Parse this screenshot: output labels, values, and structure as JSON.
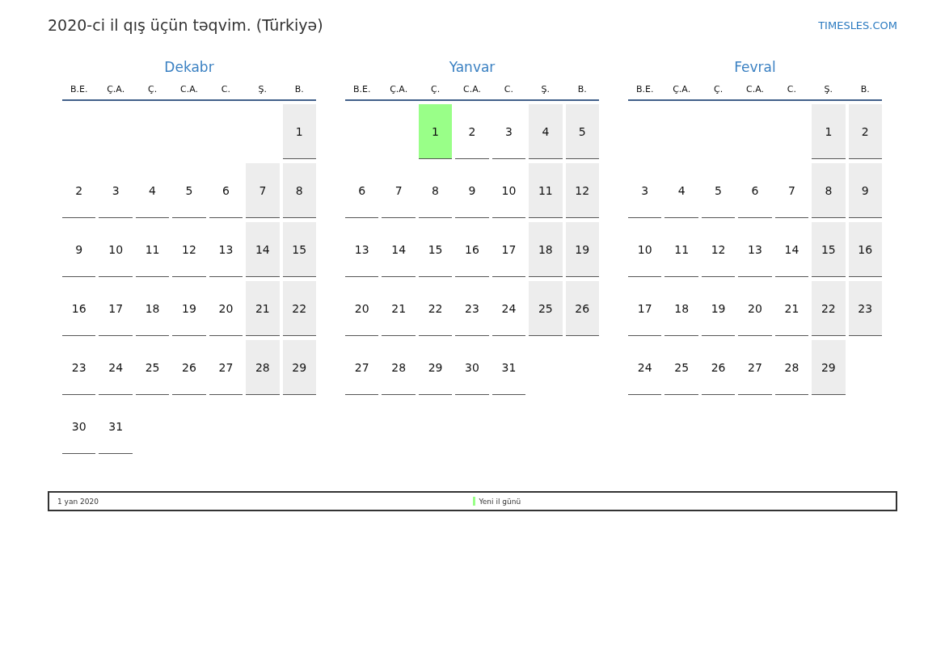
{
  "title": "2020-ci il qış üçün təqvim. (Türkiyə)",
  "site": "TIMESLES.COM",
  "months": [
    {
      "name": "Dekabr",
      "weekdays": [
        "B.E.",
        "Ç.A.",
        "Ç.",
        "C.A.",
        "C.",
        "Ş.",
        "B."
      ],
      "weeks": [
        [
          {
            "kind": "empty"
          },
          {
            "kind": "empty"
          },
          {
            "kind": "empty"
          },
          {
            "kind": "empty"
          },
          {
            "kind": "empty"
          },
          {
            "kind": "empty"
          },
          {
            "kind": "day",
            "day": "1",
            "weekend": true,
            "holiday": false
          }
        ],
        [
          {
            "kind": "day",
            "day": "2",
            "weekend": false,
            "holiday": false
          },
          {
            "kind": "day",
            "day": "3",
            "weekend": false,
            "holiday": false
          },
          {
            "kind": "day",
            "day": "4",
            "weekend": false,
            "holiday": false
          },
          {
            "kind": "day",
            "day": "5",
            "weekend": false,
            "holiday": false
          },
          {
            "kind": "day",
            "day": "6",
            "weekend": false,
            "holiday": false
          },
          {
            "kind": "day",
            "day": "7",
            "weekend": true,
            "holiday": false
          },
          {
            "kind": "day",
            "day": "8",
            "weekend": true,
            "holiday": false
          }
        ],
        [
          {
            "kind": "day",
            "day": "9",
            "weekend": false,
            "holiday": false
          },
          {
            "kind": "day",
            "day": "10",
            "weekend": false,
            "holiday": false
          },
          {
            "kind": "day",
            "day": "11",
            "weekend": false,
            "holiday": false
          },
          {
            "kind": "day",
            "day": "12",
            "weekend": false,
            "holiday": false
          },
          {
            "kind": "day",
            "day": "13",
            "weekend": false,
            "holiday": false
          },
          {
            "kind": "day",
            "day": "14",
            "weekend": true,
            "holiday": false
          },
          {
            "kind": "day",
            "day": "15",
            "weekend": true,
            "holiday": false
          }
        ],
        [
          {
            "kind": "day",
            "day": "16",
            "weekend": false,
            "holiday": false
          },
          {
            "kind": "day",
            "day": "17",
            "weekend": false,
            "holiday": false
          },
          {
            "kind": "day",
            "day": "18",
            "weekend": false,
            "holiday": false
          },
          {
            "kind": "day",
            "day": "19",
            "weekend": false,
            "holiday": false
          },
          {
            "kind": "day",
            "day": "20",
            "weekend": false,
            "holiday": false
          },
          {
            "kind": "day",
            "day": "21",
            "weekend": true,
            "holiday": false
          },
          {
            "kind": "day",
            "day": "22",
            "weekend": true,
            "holiday": false
          }
        ],
        [
          {
            "kind": "day",
            "day": "23",
            "weekend": false,
            "holiday": false
          },
          {
            "kind": "day",
            "day": "24",
            "weekend": false,
            "holiday": false
          },
          {
            "kind": "day",
            "day": "25",
            "weekend": false,
            "holiday": false
          },
          {
            "kind": "day",
            "day": "26",
            "weekend": false,
            "holiday": false
          },
          {
            "kind": "day",
            "day": "27",
            "weekend": false,
            "holiday": false
          },
          {
            "kind": "day",
            "day": "28",
            "weekend": true,
            "holiday": false
          },
          {
            "kind": "day",
            "day": "29",
            "weekend": true,
            "holiday": false
          }
        ],
        [
          {
            "kind": "day",
            "day": "30",
            "weekend": false,
            "holiday": false
          },
          {
            "kind": "day",
            "day": "31",
            "weekend": false,
            "holiday": false
          }
        ]
      ]
    },
    {
      "name": "Yanvar",
      "weekdays": [
        "B.E.",
        "Ç.A.",
        "Ç.",
        "C.A.",
        "C.",
        "Ş.",
        "B."
      ],
      "weeks": [
        [
          {
            "kind": "empty"
          },
          {
            "kind": "empty"
          },
          {
            "kind": "day",
            "day": "1",
            "weekend": false,
            "holiday": true
          },
          {
            "kind": "day",
            "day": "2",
            "weekend": false,
            "holiday": false
          },
          {
            "kind": "day",
            "day": "3",
            "weekend": false,
            "holiday": false
          },
          {
            "kind": "day",
            "day": "4",
            "weekend": true,
            "holiday": false
          },
          {
            "kind": "day",
            "day": "5",
            "weekend": true,
            "holiday": false
          }
        ],
        [
          {
            "kind": "day",
            "day": "6",
            "weekend": false,
            "holiday": false
          },
          {
            "kind": "day",
            "day": "7",
            "weekend": false,
            "holiday": false
          },
          {
            "kind": "day",
            "day": "8",
            "weekend": false,
            "holiday": false
          },
          {
            "kind": "day",
            "day": "9",
            "weekend": false,
            "holiday": false
          },
          {
            "kind": "day",
            "day": "10",
            "weekend": false,
            "holiday": false
          },
          {
            "kind": "day",
            "day": "11",
            "weekend": true,
            "holiday": false
          },
          {
            "kind": "day",
            "day": "12",
            "weekend": true,
            "holiday": false
          }
        ],
        [
          {
            "kind": "day",
            "day": "13",
            "weekend": false,
            "holiday": false
          },
          {
            "kind": "day",
            "day": "14",
            "weekend": false,
            "holiday": false
          },
          {
            "kind": "day",
            "day": "15",
            "weekend": false,
            "holiday": false
          },
          {
            "kind": "day",
            "day": "16",
            "weekend": false,
            "holiday": false
          },
          {
            "kind": "day",
            "day": "17",
            "weekend": false,
            "holiday": false
          },
          {
            "kind": "day",
            "day": "18",
            "weekend": true,
            "holiday": false
          },
          {
            "kind": "day",
            "day": "19",
            "weekend": true,
            "holiday": false
          }
        ],
        [
          {
            "kind": "day",
            "day": "20",
            "weekend": false,
            "holiday": false
          },
          {
            "kind": "day",
            "day": "21",
            "weekend": false,
            "holiday": false
          },
          {
            "kind": "day",
            "day": "22",
            "weekend": false,
            "holiday": false
          },
          {
            "kind": "day",
            "day": "23",
            "weekend": false,
            "holiday": false
          },
          {
            "kind": "day",
            "day": "24",
            "weekend": false,
            "holiday": false
          },
          {
            "kind": "day",
            "day": "25",
            "weekend": true,
            "holiday": false
          },
          {
            "kind": "day",
            "day": "26",
            "weekend": true,
            "holiday": false
          }
        ],
        [
          {
            "kind": "day",
            "day": "27",
            "weekend": false,
            "holiday": false
          },
          {
            "kind": "day",
            "day": "28",
            "weekend": false,
            "holiday": false
          },
          {
            "kind": "day",
            "day": "29",
            "weekend": false,
            "holiday": false
          },
          {
            "kind": "day",
            "day": "30",
            "weekend": false,
            "holiday": false
          },
          {
            "kind": "day",
            "day": "31",
            "weekend": false,
            "holiday": false
          }
        ]
      ]
    },
    {
      "name": "Fevral",
      "weekdays": [
        "B.E.",
        "Ç.A.",
        "Ç.",
        "C.A.",
        "C.",
        "Ş.",
        "B."
      ],
      "weeks": [
        [
          {
            "kind": "empty"
          },
          {
            "kind": "empty"
          },
          {
            "kind": "empty"
          },
          {
            "kind": "empty"
          },
          {
            "kind": "empty"
          },
          {
            "kind": "day",
            "day": "1",
            "weekend": true,
            "holiday": false
          },
          {
            "kind": "day",
            "day": "2",
            "weekend": true,
            "holiday": false
          }
        ],
        [
          {
            "kind": "day",
            "day": "3",
            "weekend": false,
            "holiday": false
          },
          {
            "kind": "day",
            "day": "4",
            "weekend": false,
            "holiday": false
          },
          {
            "kind": "day",
            "day": "5",
            "weekend": false,
            "holiday": false
          },
          {
            "kind": "day",
            "day": "6",
            "weekend": false,
            "holiday": false
          },
          {
            "kind": "day",
            "day": "7",
            "weekend": false,
            "holiday": false
          },
          {
            "kind": "day",
            "day": "8",
            "weekend": true,
            "holiday": false
          },
          {
            "kind": "day",
            "day": "9",
            "weekend": true,
            "holiday": false
          }
        ],
        [
          {
            "kind": "day",
            "day": "10",
            "weekend": false,
            "holiday": false
          },
          {
            "kind": "day",
            "day": "11",
            "weekend": false,
            "holiday": false
          },
          {
            "kind": "day",
            "day": "12",
            "weekend": false,
            "holiday": false
          },
          {
            "kind": "day",
            "day": "13",
            "weekend": false,
            "holiday": false
          },
          {
            "kind": "day",
            "day": "14",
            "weekend": false,
            "holiday": false
          },
          {
            "kind": "day",
            "day": "15",
            "weekend": true,
            "holiday": false
          },
          {
            "kind": "day",
            "day": "16",
            "weekend": true,
            "holiday": false
          }
        ],
        [
          {
            "kind": "day",
            "day": "17",
            "weekend": false,
            "holiday": false
          },
          {
            "kind": "day",
            "day": "18",
            "weekend": false,
            "holiday": false
          },
          {
            "kind": "day",
            "day": "19",
            "weekend": false,
            "holiday": false
          },
          {
            "kind": "day",
            "day": "20",
            "weekend": false,
            "holiday": false
          },
          {
            "kind": "day",
            "day": "21",
            "weekend": false,
            "holiday": false
          },
          {
            "kind": "day",
            "day": "22",
            "weekend": true,
            "holiday": false
          },
          {
            "kind": "day",
            "day": "23",
            "weekend": true,
            "holiday": false
          }
        ],
        [
          {
            "kind": "day",
            "day": "24",
            "weekend": false,
            "holiday": false
          },
          {
            "kind": "day",
            "day": "25",
            "weekend": false,
            "holiday": false
          },
          {
            "kind": "day",
            "day": "26",
            "weekend": false,
            "holiday": false
          },
          {
            "kind": "day",
            "day": "27",
            "weekend": false,
            "holiday": false
          },
          {
            "kind": "day",
            "day": "28",
            "weekend": false,
            "holiday": false
          },
          {
            "kind": "day",
            "day": "29",
            "weekend": true,
            "holiday": false
          }
        ]
      ]
    }
  ],
  "legend": {
    "date": "1 yan 2020",
    "name": "Yeni il günü",
    "color": "#99ff88"
  }
}
